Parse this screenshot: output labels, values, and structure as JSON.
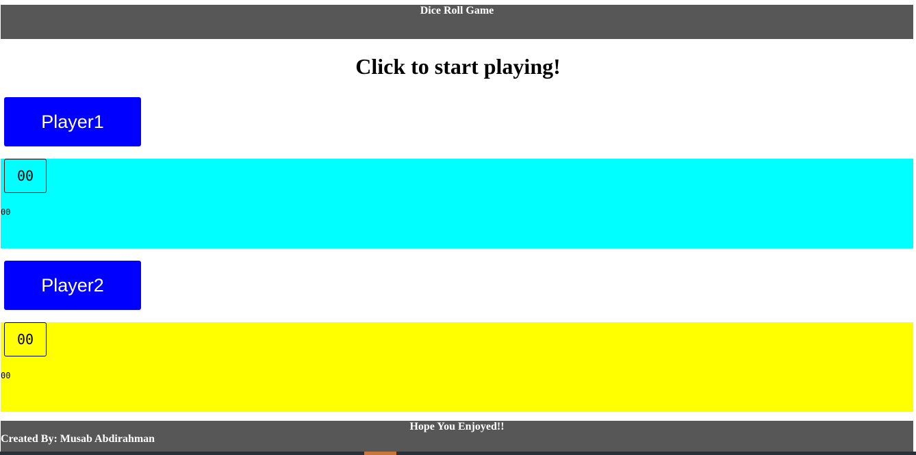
{
  "header": {
    "title": "Dice Roll Game"
  },
  "main": {
    "heading": "Click to start playing!"
  },
  "players": [
    {
      "button_label": "Player1",
      "score_display": "00",
      "score_text": "00",
      "panel_color": "#00ffff"
    },
    {
      "button_label": "Player2",
      "score_display": "00",
      "score_text": "00",
      "panel_color": "#ffff00"
    }
  ],
  "footer": {
    "message": "Hope You Enjoyed!!",
    "credit": "Created By: Musab Abdirahman"
  },
  "colors": {
    "bar": "#575757",
    "button": "#0000ff"
  }
}
